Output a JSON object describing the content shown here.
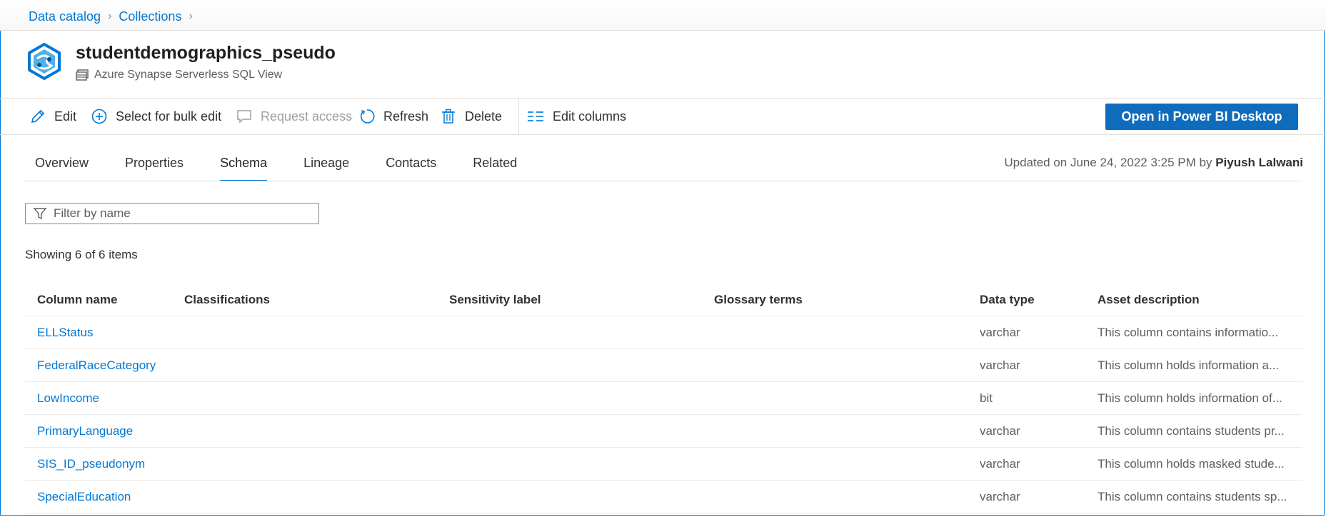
{
  "breadcrumb": {
    "items": [
      "Data catalog",
      "Collections"
    ]
  },
  "asset": {
    "title": "studentdemographics_pseudo",
    "type": "Azure Synapse Serverless SQL View"
  },
  "toolbar": {
    "edit": "Edit",
    "bulk_edit": "Select for bulk edit",
    "request_access": "Request access",
    "refresh": "Refresh",
    "delete": "Delete",
    "edit_columns": "Edit columns",
    "open_powerbi": "Open in Power BI Desktop"
  },
  "tabs": [
    {
      "label": "Overview"
    },
    {
      "label": "Properties"
    },
    {
      "label": "Schema",
      "active": true
    },
    {
      "label": "Lineage"
    },
    {
      "label": "Contacts"
    },
    {
      "label": "Related"
    }
  ],
  "updated": {
    "prefix": "Updated on June 24, 2022 3:25 PM by",
    "user": "Piyush Lalwani"
  },
  "filter": {
    "placeholder": "Filter by name",
    "value": ""
  },
  "showing": "Showing 6 of 6 items",
  "table": {
    "headers": [
      "Column name",
      "Classifications",
      "Sensitivity label",
      "Glossary terms",
      "Data type",
      "Asset description"
    ],
    "rows": [
      {
        "name": "ELLStatus",
        "type": "varchar",
        "desc": "This column contains informatio..."
      },
      {
        "name": "FederalRaceCategory",
        "type": "varchar",
        "desc": "This column holds information a..."
      },
      {
        "name": "LowIncome",
        "type": "bit",
        "desc": "This column holds information of..."
      },
      {
        "name": "PrimaryLanguage",
        "type": "varchar",
        "desc": "This column contains students pr..."
      },
      {
        "name": "SIS_ID_pseudonym",
        "type": "varchar",
        "desc": "This column holds masked stude..."
      },
      {
        "name": "SpecialEducation",
        "type": "varchar",
        "desc": "This column contains students sp..."
      }
    ]
  },
  "colors": {
    "accent": "#0078d4",
    "primary_button": "#0f6cbd",
    "text": "#323130",
    "muted": "#605e5c"
  },
  "icons": [
    "synapse-icon",
    "view-icon",
    "pencil-icon",
    "plus-circle-icon",
    "comment-icon",
    "refresh-icon",
    "trash-icon",
    "columns-icon",
    "filter-icon",
    "chevron-right-icon"
  ]
}
